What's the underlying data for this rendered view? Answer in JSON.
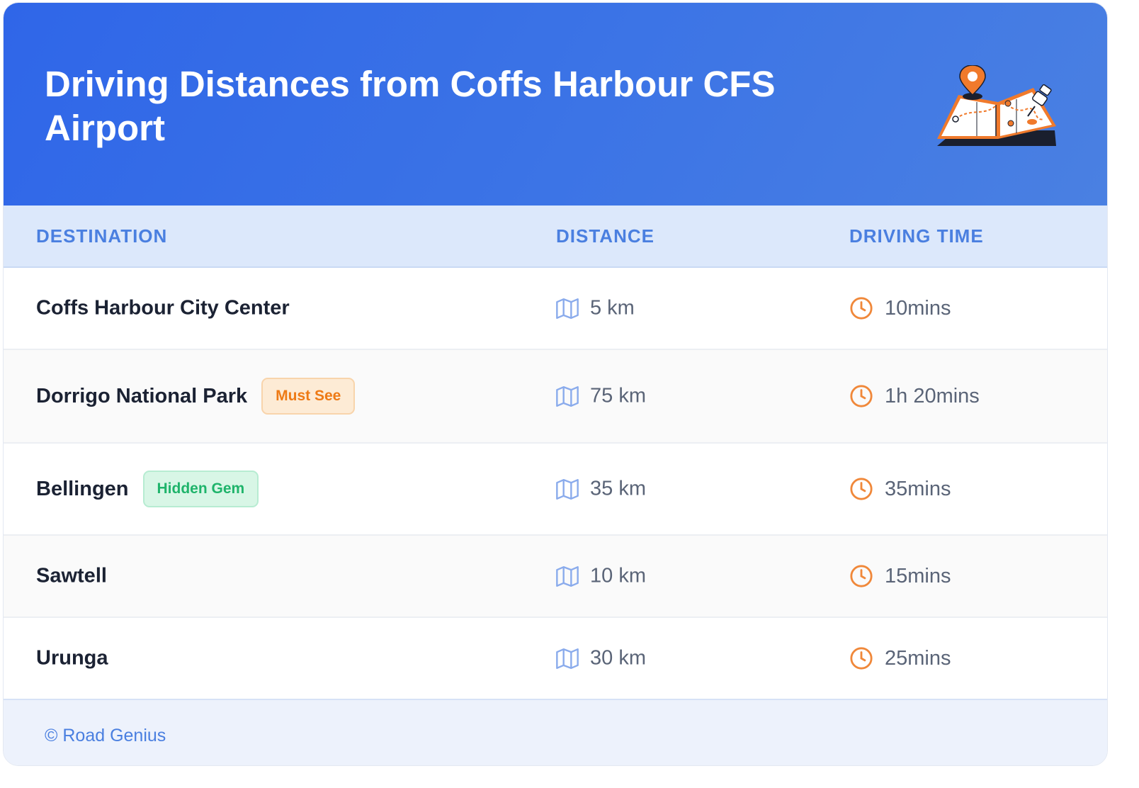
{
  "header": {
    "title": "Driving Distances from Coffs Harbour CFS Airport",
    "illustration": "map-pin-icon"
  },
  "columns": {
    "destination": "DESTINATION",
    "distance": "DISTANCE",
    "driving_time": "DRIVING TIME"
  },
  "rows": [
    {
      "destination": "Coffs Harbour City Center",
      "badge": "",
      "badge_type": "",
      "distance": "5 km",
      "time": "10mins"
    },
    {
      "destination": "Dorrigo National Park",
      "badge": "Must See",
      "badge_type": "must",
      "distance": "75 km",
      "time": "1h 20mins"
    },
    {
      "destination": "Bellingen",
      "badge": "Hidden Gem",
      "badge_type": "gem",
      "distance": "35 km",
      "time": "35mins"
    },
    {
      "destination": "Sawtell",
      "badge": "",
      "badge_type": "",
      "distance": "10 km",
      "time": "15mins"
    },
    {
      "destination": "Urunga",
      "badge": "",
      "badge_type": "",
      "distance": "30 km",
      "time": "25mins"
    }
  ],
  "icons": {
    "distance": "map-icon",
    "time": "clock-icon"
  },
  "colors": {
    "header_gradient_start": "#2f66e8",
    "header_gradient_end": "#4a80e2",
    "accent_blue": "#4a7fe0",
    "accent_orange": "#f0883a",
    "must_see_text": "#ee7a15",
    "hidden_gem_text": "#1fb46b"
  },
  "footer": {
    "text": "© Road Genius"
  }
}
